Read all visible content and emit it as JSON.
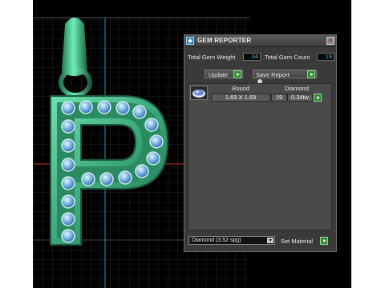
{
  "panel": {
    "title": "GEM REPORTER",
    "total_gem_weight_label": "Total Gem Weight",
    "total_gem_weight_value": ".34",
    "total_gem_count_label": "Total Gem Count",
    "total_gem_count_value": "19",
    "update_label": "Update",
    "save_report_label": "Save Report",
    "table": {
      "headers": [
        "Round",
        "Diamond"
      ],
      "rows": [
        {
          "shape_size": "1.69 X 1.69",
          "count": "19",
          "weight": "0.34tw"
        }
      ]
    },
    "material_select_value": "Diamond    (3.52 spg)",
    "set_material_label": "Set Material"
  },
  "icons": {
    "app_logo": "gem-reporter-logo-icon",
    "close": "close-icon",
    "gem": "round-gem-icon",
    "go": "green-play-icon",
    "dropdown": "chevron-down-icon"
  },
  "colors": {
    "pendant": "#3aa87a",
    "gem": "#7fb6e8",
    "value_text": "#3fb6e8",
    "panel_bg": "#3a3a3a",
    "go_button": "#2e8b2e"
  }
}
